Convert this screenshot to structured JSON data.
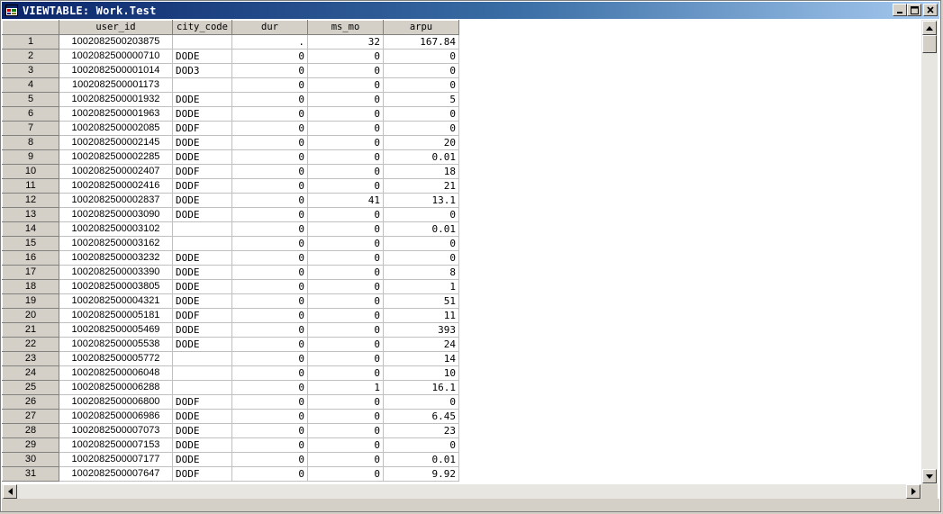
{
  "window": {
    "title": "VIEWTABLE: Work.Test",
    "icon": "viewtable-app-icon",
    "buttons": {
      "minimize": "minimize-icon",
      "maximize": "maximize-icon",
      "close": "close-icon"
    }
  },
  "table": {
    "columns": [
      "user_id",
      "city_code",
      "dur",
      "ms_mo",
      "arpu"
    ],
    "rows": [
      [
        "1",
        "1002082500203875",
        "",
        ".",
        "32",
        "167.84"
      ],
      [
        "2",
        "1002082500000710",
        "DODE",
        "0",
        "0",
        "0"
      ],
      [
        "3",
        "1002082500001014",
        "DOD3",
        "0",
        "0",
        "0"
      ],
      [
        "4",
        "1002082500001173",
        "",
        "0",
        "0",
        "0"
      ],
      [
        "5",
        "1002082500001932",
        "DODE",
        "0",
        "0",
        "5"
      ],
      [
        "6",
        "1002082500001963",
        "DODE",
        "0",
        "0",
        "0"
      ],
      [
        "7",
        "1002082500002085",
        "DODF",
        "0",
        "0",
        "0"
      ],
      [
        "8",
        "1002082500002145",
        "DODE",
        "0",
        "0",
        "20"
      ],
      [
        "9",
        "1002082500002285",
        "DODE",
        "0",
        "0",
        "0.01"
      ],
      [
        "10",
        "1002082500002407",
        "DODF",
        "0",
        "0",
        "18"
      ],
      [
        "11",
        "1002082500002416",
        "DODF",
        "0",
        "0",
        "21"
      ],
      [
        "12",
        "1002082500002837",
        "DODE",
        "0",
        "41",
        "13.1"
      ],
      [
        "13",
        "1002082500003090",
        "DODE",
        "0",
        "0",
        "0"
      ],
      [
        "14",
        "1002082500003102",
        "",
        "0",
        "0",
        "0.01"
      ],
      [
        "15",
        "1002082500003162",
        "",
        "0",
        "0",
        "0"
      ],
      [
        "16",
        "1002082500003232",
        "DODE",
        "0",
        "0",
        "0"
      ],
      [
        "17",
        "1002082500003390",
        "DODE",
        "0",
        "0",
        "8"
      ],
      [
        "18",
        "1002082500003805",
        "DODE",
        "0",
        "0",
        "1"
      ],
      [
        "19",
        "1002082500004321",
        "DODE",
        "0",
        "0",
        "51"
      ],
      [
        "20",
        "1002082500005181",
        "DODF",
        "0",
        "0",
        "11"
      ],
      [
        "21",
        "1002082500005469",
        "DODE",
        "0",
        "0",
        "393"
      ],
      [
        "22",
        "1002082500005538",
        "DODE",
        "0",
        "0",
        "24"
      ],
      [
        "23",
        "1002082500005772",
        "",
        "0",
        "0",
        "14"
      ],
      [
        "24",
        "1002082500006048",
        "",
        "0",
        "0",
        "10"
      ],
      [
        "25",
        "1002082500006288",
        "",
        "0",
        "1",
        "16.1"
      ],
      [
        "26",
        "1002082500006800",
        "DODF",
        "0",
        "0",
        "0"
      ],
      [
        "27",
        "1002082500006986",
        "DODE",
        "0",
        "0",
        "6.45"
      ],
      [
        "28",
        "1002082500007073",
        "DODE",
        "0",
        "0",
        "23"
      ],
      [
        "29",
        "1002082500007153",
        "DODE",
        "0",
        "0",
        "0"
      ],
      [
        "30",
        "1002082500007177",
        "DODE",
        "0",
        "0",
        "0.01"
      ],
      [
        "31",
        "1002082500007647",
        "DODF",
        "0",
        "0",
        "9.92"
      ]
    ]
  },
  "scrollbars": {
    "up": "arrow-up-icon",
    "down": "arrow-down-icon",
    "left": "arrow-left-icon",
    "right": "arrow-right-icon"
  }
}
